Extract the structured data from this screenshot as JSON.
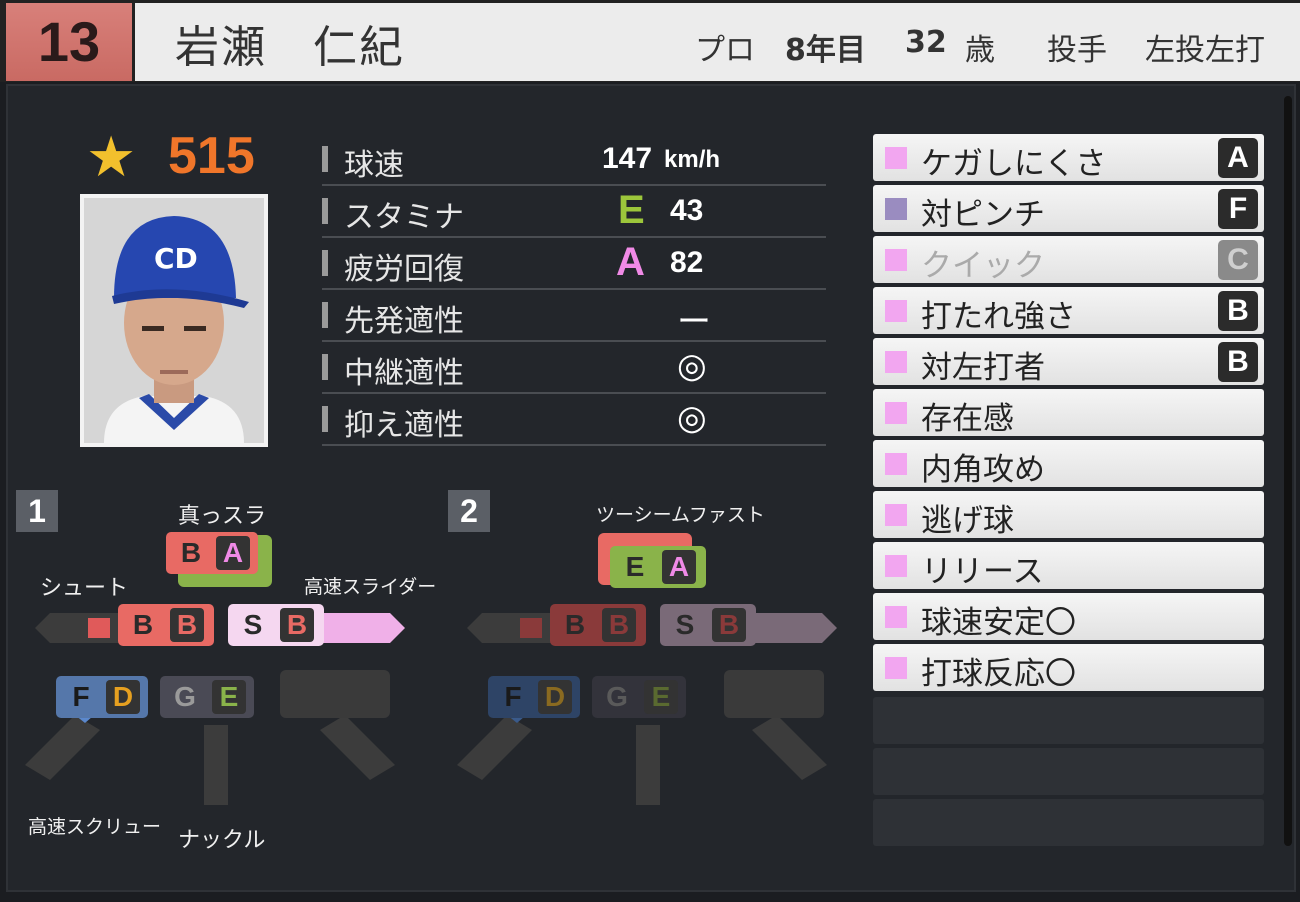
{
  "header": {
    "number": "13",
    "name": "岩瀬　仁紀",
    "pro_label": "プロ",
    "years": "8年目",
    "age": "32",
    "age_unit": "歳",
    "position": "投手",
    "hand": "左投左打"
  },
  "overall": {
    "value": "515"
  },
  "stats": [
    {
      "label": "球速",
      "value": "147",
      "unit": "km/h",
      "grade": ""
    },
    {
      "label": "スタミナ",
      "value": "43",
      "grade": "E"
    },
    {
      "label": "疲労回復",
      "value": "82",
      "grade": "A"
    },
    {
      "label": "先発適性",
      "value": "ー"
    },
    {
      "label": "中継適性",
      "value": "◎"
    },
    {
      "label": "抑え適性",
      "value": "◎"
    }
  ],
  "skills": [
    {
      "name": "ケガしにくさ",
      "rank": "A"
    },
    {
      "name": "対ピンチ",
      "rank": "F"
    },
    {
      "name": "クイック",
      "rank": "C"
    },
    {
      "name": "打たれ強さ",
      "rank": "B"
    },
    {
      "name": "対左打者",
      "rank": "B"
    },
    {
      "name": "存在感",
      "rank": ""
    },
    {
      "name": "内角攻め",
      "rank": ""
    },
    {
      "name": "逃げ球",
      "rank": ""
    },
    {
      "name": "リリース",
      "rank": ""
    },
    {
      "name": "球速安定〇",
      "rank": ""
    },
    {
      "name": "打球反応〇",
      "rank": ""
    }
  ],
  "pitch1": {
    "tag": "1",
    "labels": {
      "top": "真っスラ",
      "left": "シュート",
      "right": "高速スライダー",
      "bl": "高速スクリュー",
      "bottom": "ナックル"
    },
    "top": [
      "B",
      "A"
    ],
    "left": [
      "B",
      "B"
    ],
    "right": [
      "S",
      "B"
    ],
    "bl": [
      "F",
      "D"
    ],
    "bm": [
      "G",
      "E"
    ]
  },
  "pitch2": {
    "tag": "2",
    "labels": {
      "top": "ツーシームファスト"
    },
    "top": [
      "E",
      "A"
    ],
    "left": [
      "B",
      "B"
    ],
    "right": [
      "S",
      "B"
    ],
    "bl": [
      "F",
      "D"
    ],
    "bm": [
      "G",
      "E"
    ]
  },
  "colors": {
    "rating": "#f0762a",
    "grade_E": "#9cc63b",
    "grade_A": "#f08ae6"
  }
}
